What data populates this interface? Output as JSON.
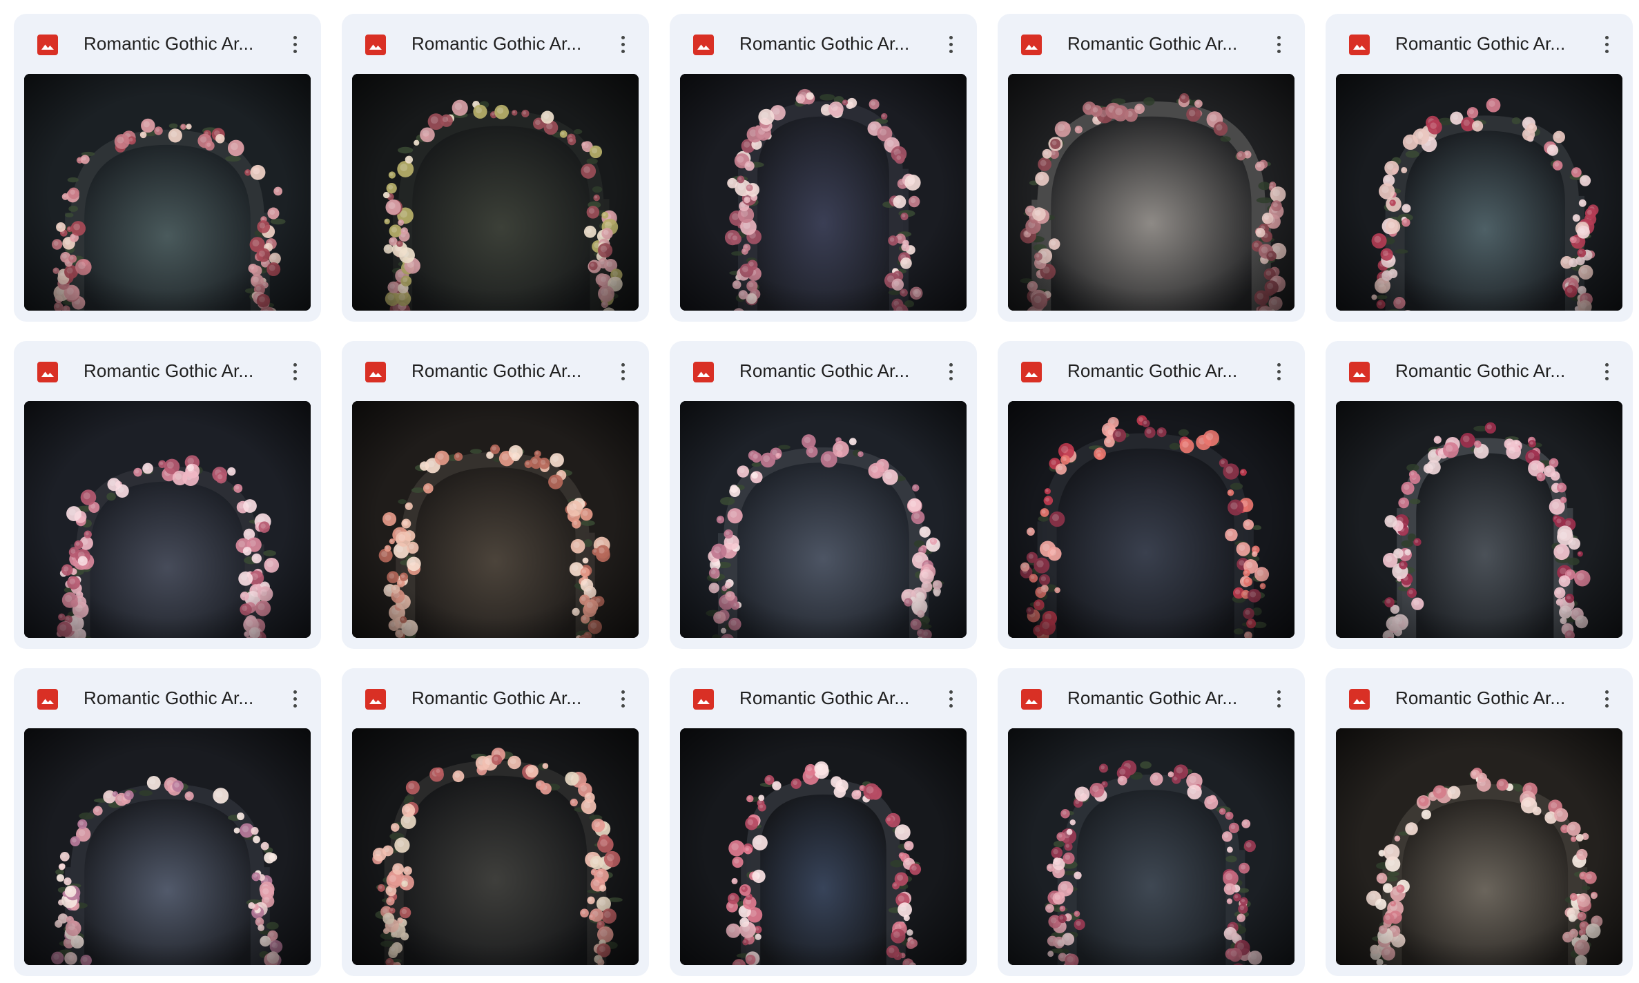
{
  "files": [
    {
      "name": "Romantic Gothic Ar...",
      "icon": "image-file-icon",
      "more_icon": "more-vert-icon",
      "thumbnail": "gothic-floral-arch-1"
    },
    {
      "name": "Romantic Gothic Ar...",
      "icon": "image-file-icon",
      "more_icon": "more-vert-icon",
      "thumbnail": "gothic-floral-arch-2"
    },
    {
      "name": "Romantic Gothic Ar...",
      "icon": "image-file-icon",
      "more_icon": "more-vert-icon",
      "thumbnail": "gothic-floral-arch-3"
    },
    {
      "name": "Romantic Gothic Ar...",
      "icon": "image-file-icon",
      "more_icon": "more-vert-icon",
      "thumbnail": "gothic-floral-arch-4"
    },
    {
      "name": "Romantic Gothic Ar...",
      "icon": "image-file-icon",
      "more_icon": "more-vert-icon",
      "thumbnail": "gothic-floral-arch-5"
    },
    {
      "name": "Romantic Gothic Ar...",
      "icon": "image-file-icon",
      "more_icon": "more-vert-icon",
      "thumbnail": "gothic-floral-arch-6"
    },
    {
      "name": "Romantic Gothic Ar...",
      "icon": "image-file-icon",
      "more_icon": "more-vert-icon",
      "thumbnail": "gothic-floral-arch-7"
    },
    {
      "name": "Romantic Gothic Ar...",
      "icon": "image-file-icon",
      "more_icon": "more-vert-icon",
      "thumbnail": "gothic-floral-arch-8"
    },
    {
      "name": "Romantic Gothic Ar...",
      "icon": "image-file-icon",
      "more_icon": "more-vert-icon",
      "thumbnail": "gothic-floral-arch-9"
    },
    {
      "name": "Romantic Gothic Ar...",
      "icon": "image-file-icon",
      "more_icon": "more-vert-icon",
      "thumbnail": "gothic-floral-arch-10"
    },
    {
      "name": "Romantic Gothic Ar...",
      "icon": "image-file-icon",
      "more_icon": "more-vert-icon",
      "thumbnail": "gothic-floral-arch-11"
    },
    {
      "name": "Romantic Gothic Ar...",
      "icon": "image-file-icon",
      "more_icon": "more-vert-icon",
      "thumbnail": "gothic-floral-arch-12"
    },
    {
      "name": "Romantic Gothic Ar...",
      "icon": "image-file-icon",
      "more_icon": "more-vert-icon",
      "thumbnail": "gothic-floral-arch-13"
    },
    {
      "name": "Romantic Gothic Ar...",
      "icon": "image-file-icon",
      "more_icon": "more-vert-icon",
      "thumbnail": "gothic-floral-arch-14"
    },
    {
      "name": "Romantic Gothic Ar...",
      "icon": "image-file-icon",
      "more_icon": "more-vert-icon",
      "thumbnail": "gothic-floral-arch-15"
    }
  ],
  "colors": {
    "card_background": "#eef2f9",
    "image_icon": "#d93025",
    "title_text": "#1f1f1f"
  }
}
